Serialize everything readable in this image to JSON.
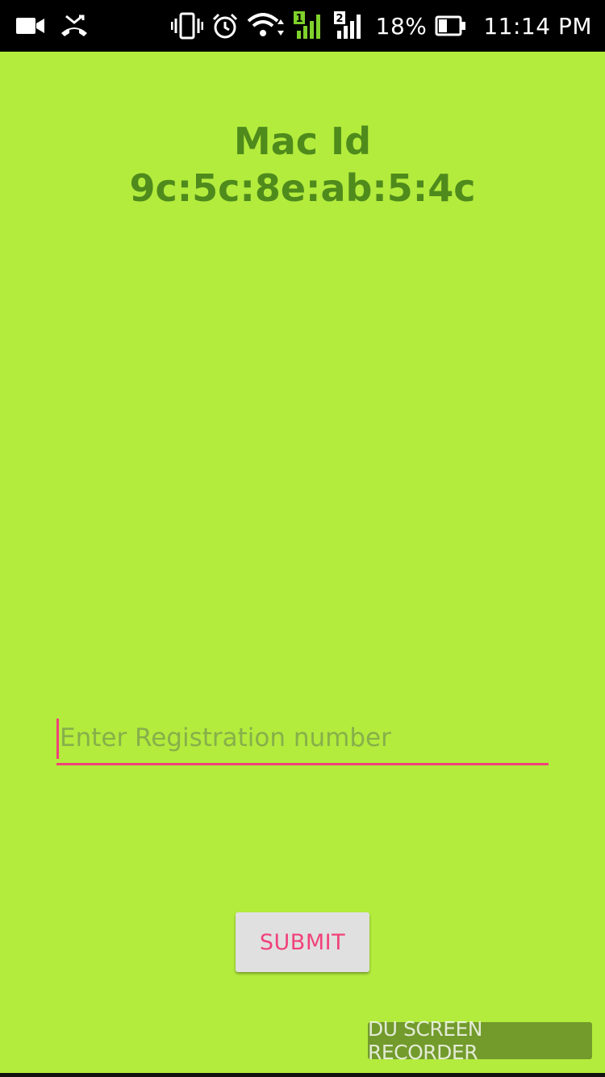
{
  "status_bar": {
    "icons": [
      "video-camera-icon",
      "missed-call-icon",
      "vibrate-icon",
      "alarm-icon",
      "wifi-icon",
      "sim1-signal-icon",
      "sim2-signal-icon",
      "battery-icon"
    ],
    "sim1_label": "1",
    "sim2_label": "2",
    "battery_percent": "18%",
    "time": "11:14 PM"
  },
  "main": {
    "mac_label": "Mac Id",
    "mac_value": "9c:5c:8e:ab:5:4c",
    "registration_input": {
      "value": "",
      "placeholder": "Enter Registration number"
    },
    "submit_label": "SUBMIT"
  },
  "watermark": {
    "text": "DU SCREEN RECORDER"
  },
  "colors": {
    "background": "#b3ec3d",
    "mac_text": "#4f8a1c",
    "accent": "#f0427a",
    "button_bg": "#e0e0e0"
  }
}
